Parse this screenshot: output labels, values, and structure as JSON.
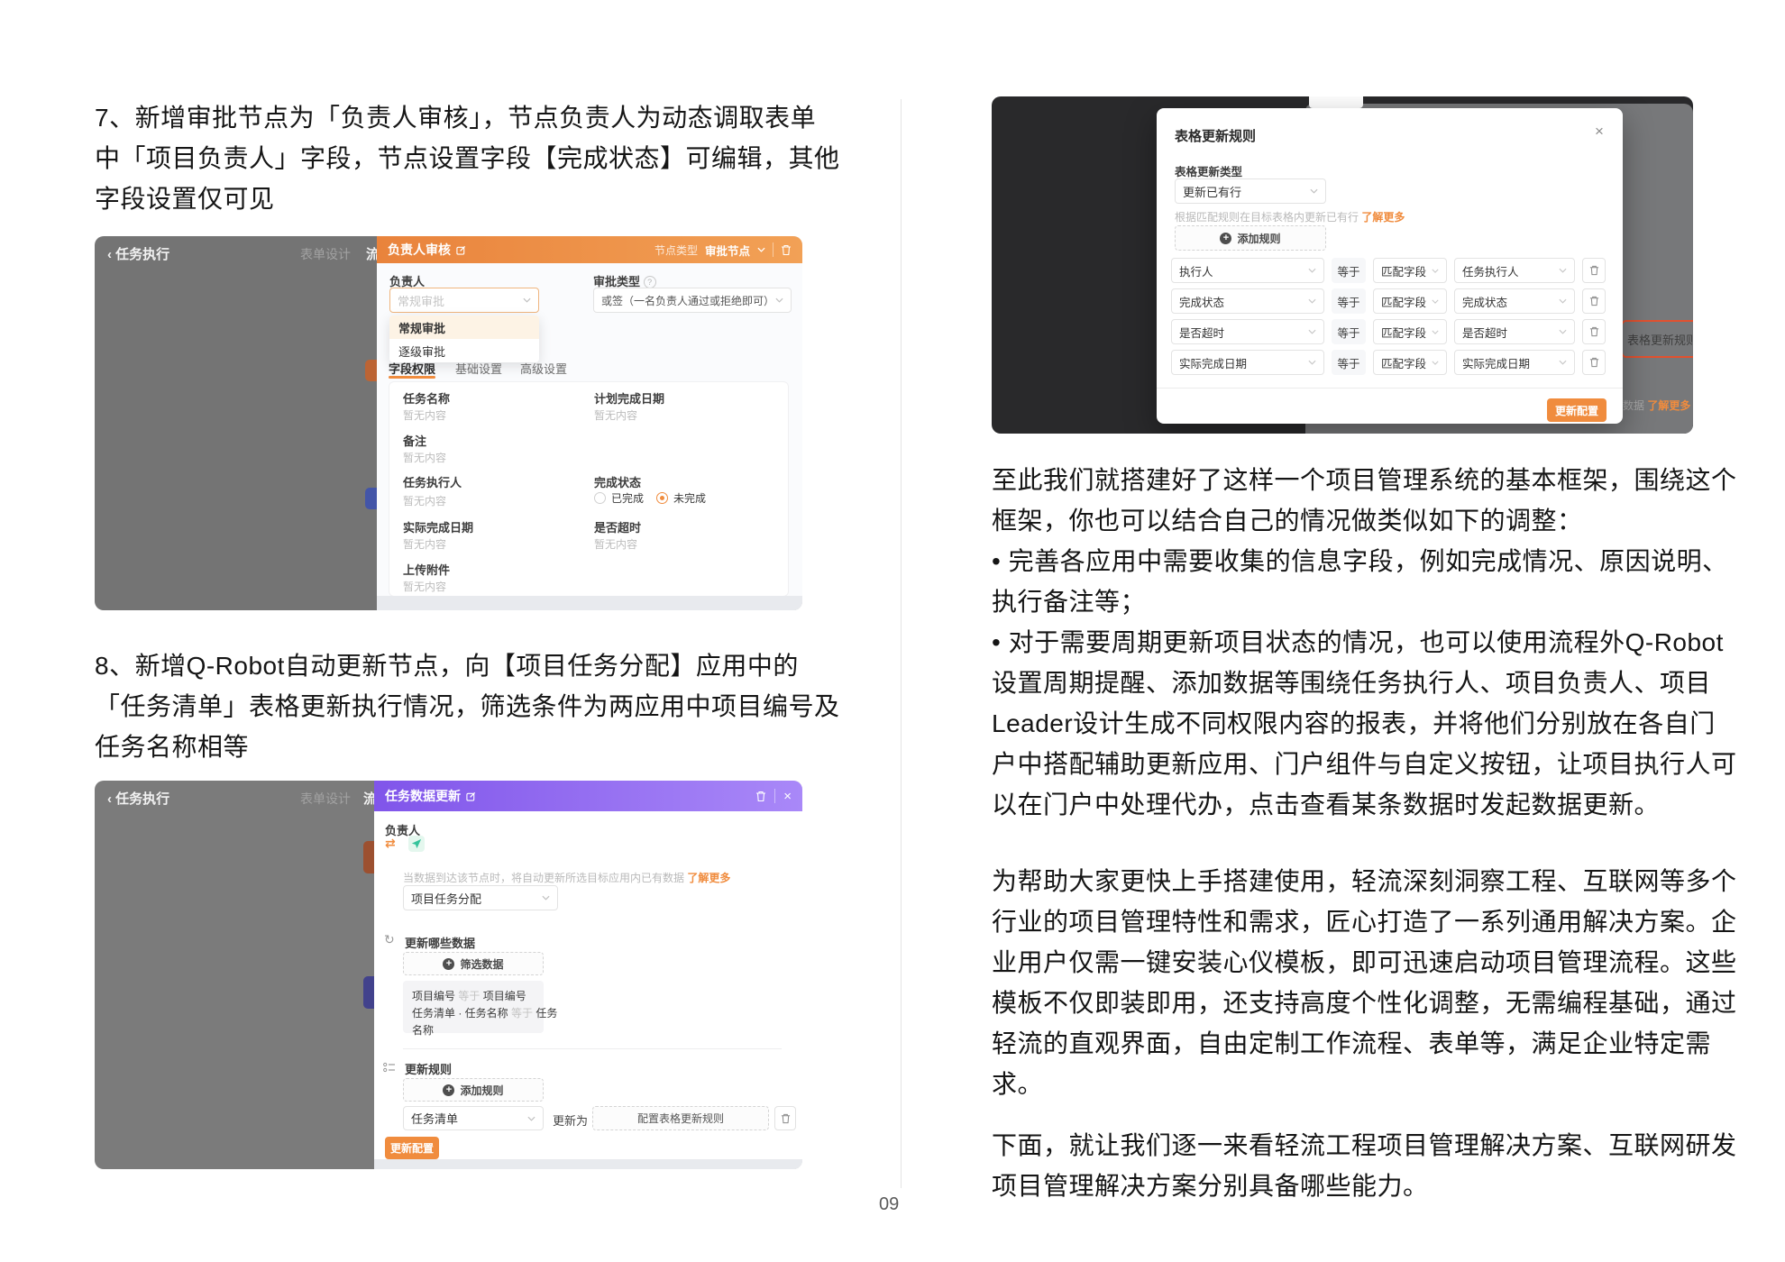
{
  "colors": {
    "accent_orange": "#F08C3E",
    "accent_purple": "#8A63F0",
    "callout_red": "#E2512F"
  },
  "page_number": "09",
  "para7": {
    "l1": "7、新增审批节点为「负责人审核」，节点负责人为动态调取表单",
    "l2": "中「项目负责人」字段，节点设置字段【完成状态】可编辑，其他",
    "l3": "字段设置仅可见"
  },
  "para8": {
    "l1": "8、新增Q-Robot自动更新节点，向【项目任务分配】应用中的",
    "l2": "「任务清单」表格更新执行情况，筛选条件为两应用中项目编号及",
    "l3": "任务名称相等"
  },
  "shot1": {
    "back": "‹",
    "nav_title": "任务执行",
    "nav_tab": "表单设计",
    "nav_clip": "流",
    "title": "负责人审核",
    "node_type_label": "节点类型",
    "node_type_value": "审批节点",
    "owner_label": "负责人",
    "owner_value": "常规审批",
    "dd1": "常规审批",
    "dd2": "逐级审批",
    "approve_label": "审批类型",
    "approve_value": "或签（一名负责人通过或拒绝即可）",
    "tab1": "字段权限",
    "tab2": "基础设置",
    "tab3": "高级设置",
    "empty": "暂无内容",
    "f1": "任务名称",
    "f2": "计划完成日期",
    "f3": "备注",
    "f4": "任务执行人",
    "f5": "完成状态",
    "r1": "已完成",
    "r2": "未完成",
    "f6": "实际完成日期",
    "f7": "是否超时",
    "f8": "上传附件"
  },
  "shot2": {
    "back": "‹",
    "nav_title": "任务执行",
    "nav_tab": "表单设计",
    "nav_clip": "流",
    "title": "任务数据更新",
    "close": "×",
    "owner_label": "负责人",
    "caption": "当数据到达该节点时，将自动更新所选目标应用内已有数据",
    "more": "了解更多",
    "app_select": "项目任务分配",
    "sec1": "更新哪些数据",
    "filter_btn": "筛选数据",
    "cond1a": "项目编号",
    "cond_eq": "等于",
    "cond1b": "项目编号",
    "cond2a": "任务清单 · 任务名称",
    "cond2b": "任务",
    "cond2c": "名称",
    "sec2": "更新规则",
    "add_btn": "添加规则",
    "row_select": "任务清单",
    "row_mid": "更新为",
    "row_target": "配置表格更新规则",
    "submit": "更新配置"
  },
  "shot3": {
    "title": "表格更新规则",
    "close": "×",
    "type_label": "表格更新类型",
    "type_value": "更新已有行",
    "help": "根据匹配规则在目标表格内更新已有行",
    "more": "了解更多",
    "add_btn": "添加规则",
    "rows": [
      {
        "field": "执行人",
        "eq": "等于",
        "match": "匹配字段",
        "target": "任务执行人"
      },
      {
        "field": "完成状态",
        "eq": "等于",
        "match": "匹配字段",
        "target": "完成状态"
      },
      {
        "field": "是否超时",
        "eq": "等于",
        "match": "匹配字段",
        "target": "是否超时"
      },
      {
        "field": "实际完成日期",
        "eq": "等于",
        "match": "匹配字段",
        "target": "实际完成日期"
      }
    ],
    "submit": "更新配置",
    "callout": "表格更新规则",
    "clip_text": "有数据",
    "clip_more": "了解更多"
  },
  "right": {
    "p1": [
      "至此我们就搭建好了这样一个项目管理系统的基本框架，围绕这个",
      "框架，你也可以结合自己的情况做类似如下的调整：",
      "• 完善各应用中需要收集的信息字段，例如完成情况、原因说明、",
      "执行备注等；",
      "• 对于需要周期更新项目状态的情况，也可以使用流程外Q-Robot",
      "设置周期提醒、添加数据等围绕任务执行人、项目负责人、项目",
      "Leader设计生成不同权限内容的报表，并将他们分别放在各自门",
      "户中搭配辅助更新应用、门户组件与自定义按钮，让项目执行人可",
      "以在门户中处理代办，点击查看某条数据时发起数据更新。"
    ],
    "p2": [
      "为帮助大家更快上手搭建使用，轻流深刻洞察工程、互联网等多个",
      "行业的项目管理特性和需求，匠心打造了一系列通用解决方案。企",
      "业用户仅需一键安装心仪模板，即可迅速启动项目管理流程。这些",
      "模板不仅即装即用，还支持高度个性化调整，无需编程基础，通过",
      "轻流的直观界面，自由定制工作流程、表单等，满足企业特定需",
      "求。"
    ],
    "p3": [
      "下面，就让我们逐一来看轻流工程项目管理解决方案、互联网研发",
      "项目管理解决方案分别具备哪些能力。"
    ]
  }
}
